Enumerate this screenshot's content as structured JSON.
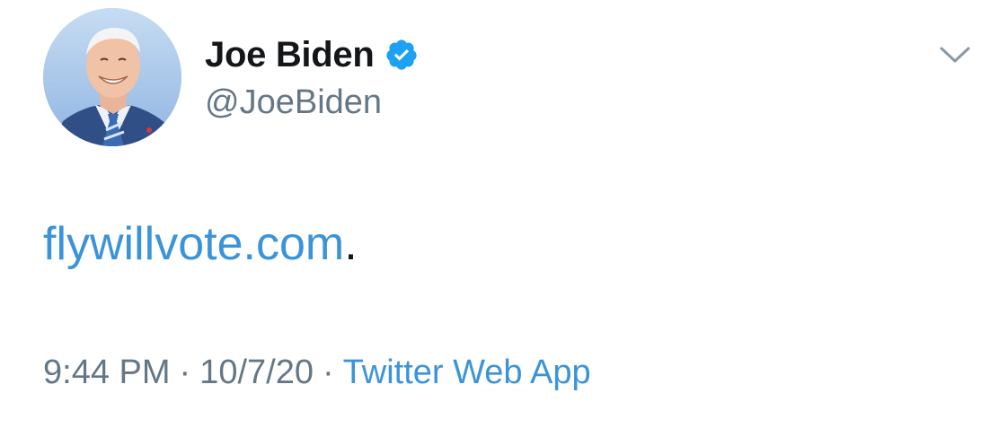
{
  "tweet": {
    "author": {
      "display_name": "Joe Biden",
      "handle": "@JoeBiden",
      "verified": true,
      "verified_icon": "verified-badge-icon",
      "avatar_icon": "profile-photo"
    },
    "menu_icon": "chevron-down-icon",
    "text": {
      "link": "flywillvote.com",
      "trailing": "."
    },
    "meta": {
      "time": "9:44 PM",
      "separator": "·",
      "date": "10/7/20",
      "source": "Twitter Web App"
    },
    "colors": {
      "link": "#3b94d9",
      "verified": "#1da1f2",
      "muted": "#657786",
      "text": "#14171a"
    }
  }
}
